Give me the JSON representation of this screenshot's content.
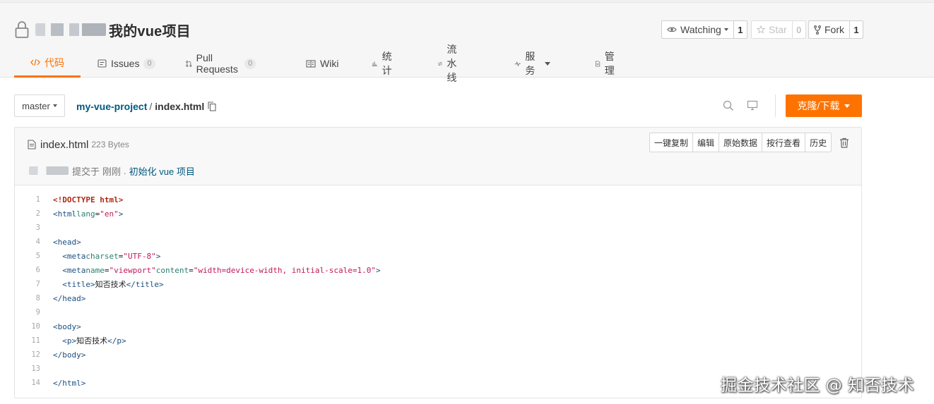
{
  "repo": {
    "name": "我的vue项目"
  },
  "social": {
    "watch_label": "Watching",
    "watch_count": "1",
    "star_label": "Star",
    "star_count": "0",
    "fork_label": "Fork",
    "fork_count": "1"
  },
  "tabs": [
    {
      "label": "代码",
      "icon": "code-icon"
    },
    {
      "label": "Issues",
      "badge": "0",
      "icon": "issues-icon"
    },
    {
      "label": "Pull Requests",
      "badge": "0",
      "icon": "pull-request-icon"
    },
    {
      "label": "Wiki",
      "icon": "wiki-icon"
    },
    {
      "label": "统计",
      "icon": "stats-icon"
    },
    {
      "label": "流水线",
      "icon": "pipeline-icon"
    },
    {
      "label": "服务",
      "icon": "service-icon"
    },
    {
      "label": "管理",
      "icon": "manage-icon"
    }
  ],
  "toolbar": {
    "branch": "master",
    "path_project": "my-vue-project",
    "path_sep": "/",
    "path_file": "index.html",
    "clone_label": "克隆/下载"
  },
  "file": {
    "name": "index.html",
    "size": "223 Bytes",
    "actions": [
      "一键复制",
      "编辑",
      "原始数据",
      "按行查看",
      "历史"
    ],
    "commit": {
      "prefix": "提交于",
      "time": "刚刚",
      "dot": ".",
      "message": "初始化 vue 项目"
    }
  },
  "code_lines": [
    "<!DOCTYPE html>",
    "<html lang=\"en\">",
    "",
    "<head>",
    "  <meta charset=\"UTF-8\">",
    "  <meta name=\"viewport\" content=\"width=device-width, initial-scale=1.0\">",
    "  <title>知否技术</title>",
    "</head>",
    "",
    "<body>",
    "  <p>知否技术</p>",
    "</body>",
    "",
    "</html>"
  ],
  "watermark": "掘金技术社区 @ 知否技术",
  "colors": {
    "accent": "#fe7300",
    "link": "#005980"
  }
}
